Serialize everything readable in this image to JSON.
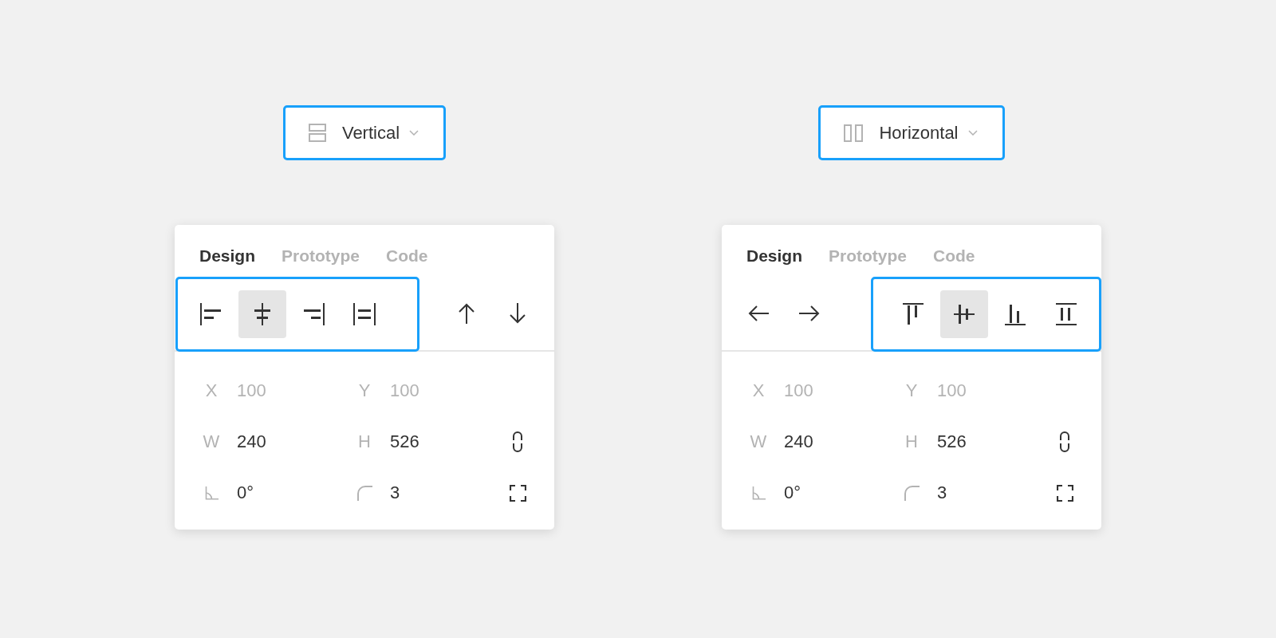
{
  "columns": [
    {
      "dropdown": {
        "kind": "vertical",
        "label": "Vertical",
        "highlighted": true
      },
      "panel": {
        "tabs": [
          {
            "label": "Design",
            "selected": true
          },
          {
            "label": "Prototype",
            "selected": false
          },
          {
            "label": "Code",
            "selected": false
          }
        ],
        "toolbar": [
          {
            "highlighted": true,
            "buttons": [
              {
                "kind": "alignleft",
                "selected": false
              },
              {
                "kind": "centerx",
                "selected": true
              },
              {
                "kind": "alignright",
                "selected": false
              },
              {
                "kind": "spreadx",
                "selected": false
              }
            ]
          },
          {
            "highlighted": false,
            "buttons": [
              {
                "kind": "up",
                "selected": false
              },
              {
                "kind": "down",
                "selected": false
              }
            ]
          }
        ],
        "rows": [
          {
            "fields": [
              {
                "kind": "text",
                "label": "X",
                "value": "100",
                "disabled": true
              },
              {
                "kind": "text",
                "label": "Y",
                "value": "100",
                "disabled": true
              }
            ]
          },
          {
            "fields": [
              {
                "kind": "text",
                "label": "W",
                "value": "240",
                "disabled": false
              },
              {
                "kind": "text",
                "label": "H",
                "value": "526",
                "disabled": false
              },
              {
                "kind": "link",
                "disabled": false
              }
            ]
          },
          {
            "fields": [
              {
                "kind": "angle",
                "value": "0°",
                "disabled": false
              },
              {
                "kind": "radius",
                "value": "3",
                "disabled": false
              },
              {
                "kind": "corners",
                "disabled": false
              }
            ]
          }
        ]
      }
    },
    {
      "dropdown": {
        "kind": "horizontal",
        "label": "Horizontal",
        "highlighted": true
      },
      "panel": {
        "tabs": [
          {
            "label": "Design",
            "selected": true
          },
          {
            "label": "Prototype",
            "selected": false
          },
          {
            "label": "Code",
            "selected": false
          }
        ],
        "toolbar": [
          {
            "highlighted": false,
            "buttons": [
              {
                "kind": "left",
                "selected": false
              },
              {
                "kind": "right",
                "selected": false
              }
            ]
          },
          {
            "highlighted": true,
            "buttons": [
              {
                "kind": "aligntop",
                "selected": false
              },
              {
                "kind": "centery",
                "selected": true
              },
              {
                "kind": "alignbottom",
                "selected": false
              },
              {
                "kind": "spready",
                "selected": false
              }
            ]
          }
        ],
        "rows": [
          {
            "fields": [
              {
                "kind": "text",
                "label": "X",
                "value": "100",
                "disabled": true
              },
              {
                "kind": "text",
                "label": "Y",
                "value": "100",
                "disabled": true
              }
            ]
          },
          {
            "fields": [
              {
                "kind": "text",
                "label": "W",
                "value": "240",
                "disabled": false
              },
              {
                "kind": "text",
                "label": "H",
                "value": "526",
                "disabled": false
              },
              {
                "kind": "link",
                "disabled": false
              }
            ]
          },
          {
            "fields": [
              {
                "kind": "angle",
                "value": "0°",
                "disabled": false
              },
              {
                "kind": "radius",
                "value": "3",
                "disabled": false
              },
              {
                "kind": "corners",
                "disabled": false
              }
            ]
          }
        ]
      }
    }
  ]
}
